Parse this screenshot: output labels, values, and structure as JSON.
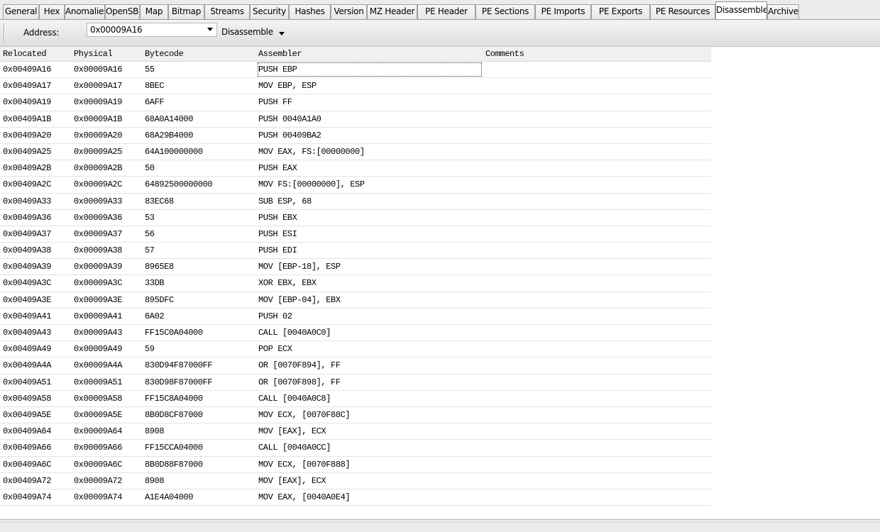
{
  "tabs": [
    {
      "label": "General",
      "active": false
    },
    {
      "label": "Hex",
      "active": false
    },
    {
      "label": "Anomalies",
      "active": false
    },
    {
      "label": "OpenSBI",
      "active": false
    },
    {
      "label": "Map",
      "active": false
    },
    {
      "label": "Bitmap",
      "active": false
    },
    {
      "label": "Streams",
      "active": false
    },
    {
      "label": "Security",
      "active": false
    },
    {
      "label": "Hashes",
      "active": false
    },
    {
      "label": "Version",
      "active": false
    },
    {
      "label": "MZ Header",
      "active": false
    },
    {
      "label": "PE Header",
      "active": false
    },
    {
      "label": "PE Sections",
      "active": false
    },
    {
      "label": "PE Imports",
      "active": false
    },
    {
      "label": "PE Exports",
      "active": false
    },
    {
      "label": "PE Resources",
      "active": false
    },
    {
      "label": "Disassembler",
      "active": true
    },
    {
      "label": "Archive",
      "active": false
    }
  ],
  "toolbar": {
    "address_label": "Address:",
    "address_value": "0x00009A16",
    "disassemble_label": "Disassemble"
  },
  "grid": {
    "columns": [
      "Relocated",
      "Physical",
      "Bytecode",
      "Assembler",
      "Comments"
    ],
    "selected_row": 0,
    "rows": [
      [
        "0x00409A16",
        "0x00009A16",
        "55",
        "PUSH EBP",
        ""
      ],
      [
        "0x00409A17",
        "0x00009A17",
        "8BEC",
        "MOV EBP, ESP",
        ""
      ],
      [
        "0x00409A19",
        "0x00009A19",
        "6AFF",
        "PUSH FF",
        ""
      ],
      [
        "0x00409A1B",
        "0x00009A1B",
        "68A0A14000",
        "PUSH 0040A1A0",
        ""
      ],
      [
        "0x00409A20",
        "0x00009A20",
        "68A29B4000",
        "PUSH 00409BA2",
        ""
      ],
      [
        "0x00409A25",
        "0x00009A25",
        "64A100000000",
        "MOV EAX, FS:[00000000]",
        ""
      ],
      [
        "0x00409A2B",
        "0x00009A2B",
        "50",
        "PUSH EAX",
        ""
      ],
      [
        "0x00409A2C",
        "0x00009A2C",
        "64892500000000",
        "MOV FS:[00000000], ESP",
        ""
      ],
      [
        "0x00409A33",
        "0x00009A33",
        "83EC68",
        "SUB ESP, 68",
        ""
      ],
      [
        "0x00409A36",
        "0x00009A36",
        "53",
        "PUSH EBX",
        ""
      ],
      [
        "0x00409A37",
        "0x00009A37",
        "56",
        "PUSH ESI",
        ""
      ],
      [
        "0x00409A38",
        "0x00009A38",
        "57",
        "PUSH EDI",
        ""
      ],
      [
        "0x00409A39",
        "0x00009A39",
        "8965E8",
        "MOV [EBP-18], ESP",
        ""
      ],
      [
        "0x00409A3C",
        "0x00009A3C",
        "33DB",
        "XOR EBX, EBX",
        ""
      ],
      [
        "0x00409A3E",
        "0x00009A3E",
        "895DFC",
        "MOV [EBP-04], EBX",
        ""
      ],
      [
        "0x00409A41",
        "0x00009A41",
        "6A02",
        "PUSH 02",
        ""
      ],
      [
        "0x00409A43",
        "0x00009A43",
        "FF15C0A04000",
        "CALL [0040A0C0]",
        ""
      ],
      [
        "0x00409A49",
        "0x00009A49",
        "59",
        "POP ECX",
        ""
      ],
      [
        "0x00409A4A",
        "0x00009A4A",
        "830D94F87000FF",
        "OR [0070F894], FF",
        ""
      ],
      [
        "0x00409A51",
        "0x00009A51",
        "830D98F87000FF",
        "OR [0070F898], FF",
        ""
      ],
      [
        "0x00409A58",
        "0x00009A58",
        "FF15C8A04000",
        "CALL [0040A0C8]",
        ""
      ],
      [
        "0x00409A5E",
        "0x00009A5E",
        "8B0D8CF87000",
        "MOV ECX, [0070F88C]",
        ""
      ],
      [
        "0x00409A64",
        "0x00009A64",
        "8908",
        "MOV [EAX], ECX",
        ""
      ],
      [
        "0x00409A66",
        "0x00009A66",
        "FF15CCA04000",
        "CALL [0040A0CC]",
        ""
      ],
      [
        "0x00409A6C",
        "0x00009A6C",
        "8B0D88F87000",
        "MOV ECX, [0070F888]",
        ""
      ],
      [
        "0x00409A72",
        "0x00009A72",
        "8908",
        "MOV [EAX], ECX",
        ""
      ],
      [
        "0x00409A74",
        "0x00009A74",
        "A1E4A04000",
        "MOV EAX, [0040A0E4]",
        ""
      ]
    ]
  }
}
